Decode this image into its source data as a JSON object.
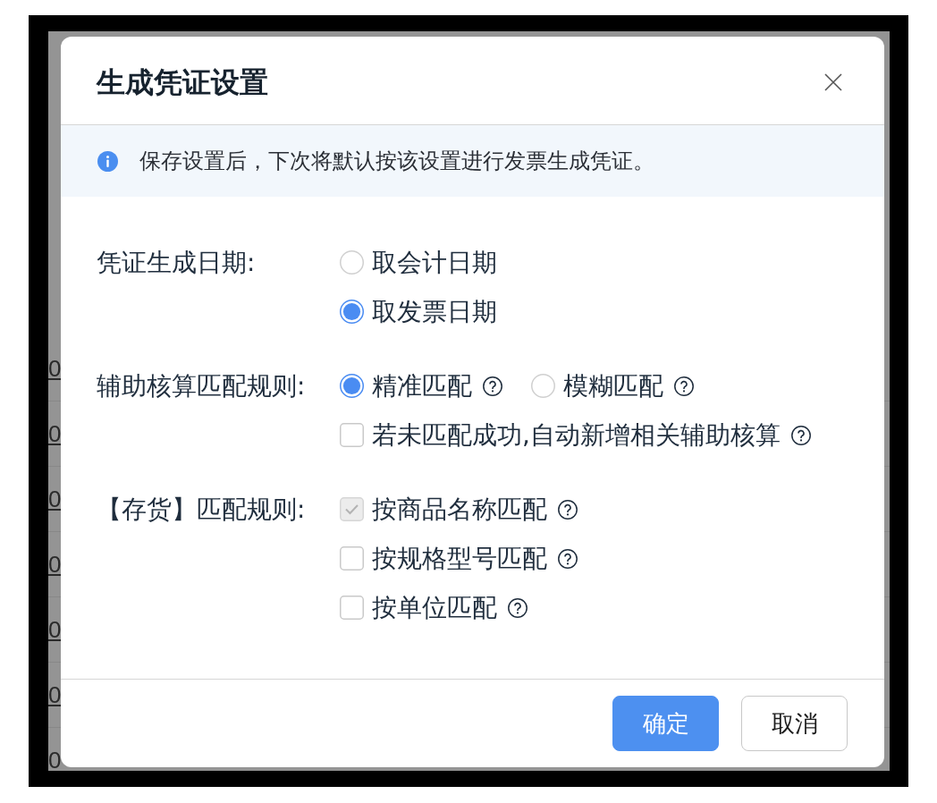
{
  "background_table": {
    "rows": [
      {
        "cell": "0",
        "kind": "link"
      },
      {
        "cell": "0",
        "kind": "link"
      },
      {
        "cell": "0",
        "kind": "link"
      },
      {
        "cell": "0",
        "kind": "link"
      },
      {
        "cell": "0",
        "kind": "link"
      },
      {
        "cell": "0",
        "kind": "link"
      },
      {
        "cell": "0",
        "kind": "text"
      }
    ]
  },
  "dialog": {
    "title": "生成凭证设置",
    "notice": "保存设置后，下次将默认按该设置进行发票生成凭证。",
    "fields": [
      {
        "label": "凭证生成日期:",
        "rows": [
          {
            "options": [
              {
                "kind": "radio",
                "label": "取会计日期",
                "selected": false
              }
            ]
          },
          {
            "options": [
              {
                "kind": "radio",
                "label": "取发票日期",
                "selected": true
              }
            ]
          }
        ]
      },
      {
        "label": "辅助核算匹配规则:",
        "rows": [
          {
            "options": [
              {
                "kind": "radio",
                "label": "精准匹配",
                "selected": true,
                "help": true
              },
              {
                "kind": "radio",
                "label": "模糊匹配",
                "selected": false,
                "help": true
              }
            ]
          },
          {
            "options": [
              {
                "kind": "checkbox",
                "label": "若未匹配成功,自动新增相关辅助核算",
                "checked": false,
                "disabled": false,
                "help": true
              }
            ]
          }
        ]
      },
      {
        "label": "【存货】匹配规则:",
        "rows": [
          {
            "options": [
              {
                "kind": "checkbox",
                "label": "按商品名称匹配",
                "checked": true,
                "disabled": true,
                "help": true
              }
            ]
          },
          {
            "options": [
              {
                "kind": "checkbox",
                "label": "按规格型号匹配",
                "checked": false,
                "disabled": false,
                "help": true
              }
            ]
          },
          {
            "options": [
              {
                "kind": "checkbox",
                "label": "按单位匹配",
                "checked": false,
                "disabled": false,
                "help": true
              }
            ]
          }
        ]
      }
    ],
    "buttons": [
      {
        "label": "确定",
        "kind": "primary"
      },
      {
        "label": "取消",
        "kind": "default"
      }
    ]
  }
}
